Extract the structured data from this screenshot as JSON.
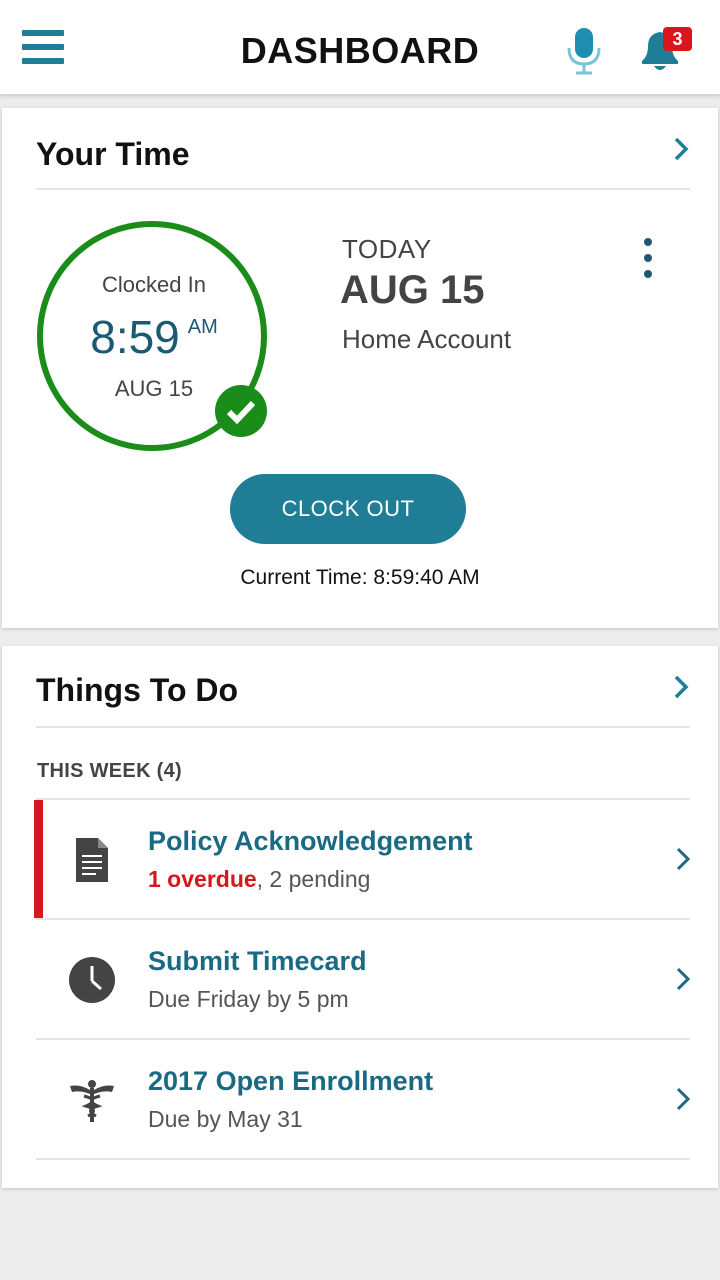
{
  "header": {
    "title": "DASHBOARD",
    "notification_count": "3"
  },
  "your_time": {
    "title": "Your Time",
    "ring": {
      "status": "Clocked In",
      "time": "8:59",
      "ampm": "AM",
      "date": "AUG 15"
    },
    "today_label": "TODAY",
    "today_date": "AUG 15",
    "account": "Home Account",
    "clock_out_label": "CLOCK OUT",
    "current_time": "Current Time: 8:59:40 AM"
  },
  "things_to_do": {
    "title": "Things To Do",
    "section_label": "THIS WEEK (4)",
    "tasks": [
      {
        "title": "Policy Acknowledgement",
        "overdue_text": "1 overdue",
        "sub_text": ", 2 pending",
        "icon": "document-icon",
        "flagged": true
      },
      {
        "title": "Submit Timecard",
        "sub_text": "Due Friday by 5 pm",
        "icon": "clock-icon"
      },
      {
        "title": "2017 Open Enrollment",
        "sub_text": "Due by May 31",
        "icon": "caduceus-icon"
      }
    ]
  },
  "colors": {
    "accent": "#1f7e96",
    "accent_dark": "#1a5a72",
    "clocked_in_green": "#1a8c1a",
    "alert_red": "#d8161c"
  }
}
